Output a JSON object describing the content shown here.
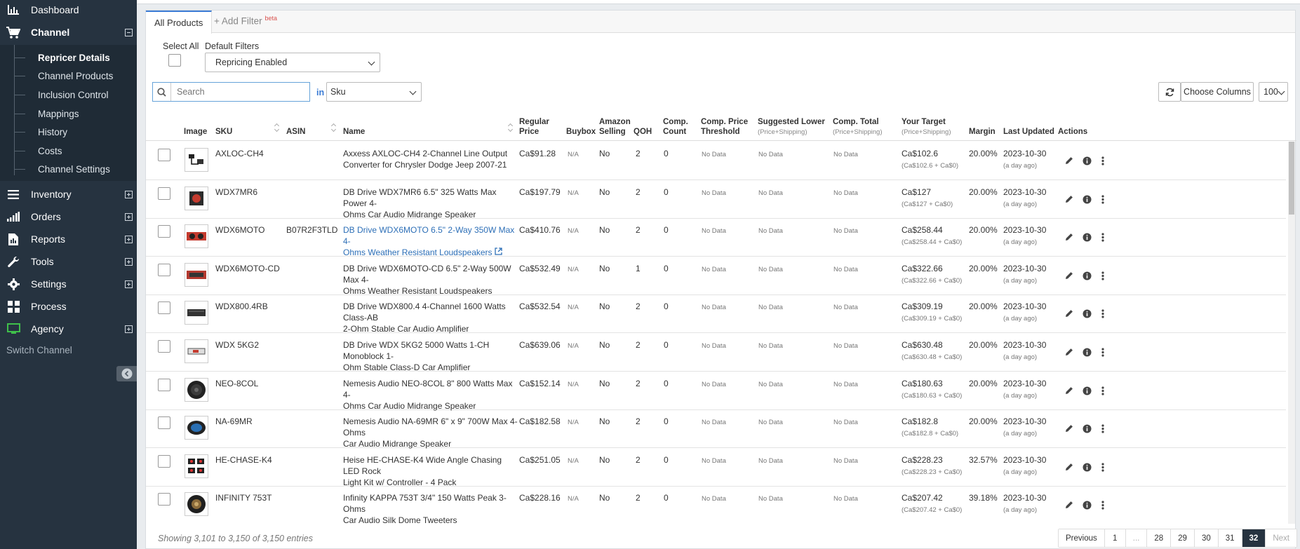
{
  "sidebar": {
    "items": [
      {
        "label": "Dashboard",
        "icon": "bar-chart-icon"
      },
      {
        "label": "Channel",
        "icon": "cart-icon"
      },
      {
        "label": "Inventory",
        "icon": "list-icon"
      },
      {
        "label": "Orders",
        "icon": "signal-icon"
      },
      {
        "label": "Reports",
        "icon": "report-icon"
      },
      {
        "label": "Tools",
        "icon": "wrench-icon"
      },
      {
        "label": "Settings",
        "icon": "gear-icon"
      },
      {
        "label": "Process",
        "icon": "process-icon"
      },
      {
        "label": "Agency",
        "icon": "monitor-icon"
      }
    ],
    "submenu": [
      {
        "label": "Repricer Details"
      },
      {
        "label": "Channel Products"
      },
      {
        "label": "Inclusion Control"
      },
      {
        "label": "Mappings"
      },
      {
        "label": "History"
      },
      {
        "label": "Costs"
      },
      {
        "label": "Channel Settings"
      }
    ],
    "switch_channel": "Switch Channel"
  },
  "tabs": {
    "all_products": "All Products",
    "add_filter": "Add Filter",
    "beta": "beta"
  },
  "filters": {
    "select_all": "Select All",
    "default_filters": "Default Filters",
    "default_filter_value": "Repricing Enabled",
    "search_placeholder": "Search",
    "in": "in",
    "search_field": "Sku",
    "choose_columns": "Choose Columns",
    "page_size": "100"
  },
  "columns": {
    "image": "Image",
    "sku": "SKU",
    "asin": "ASIN",
    "name": "Name",
    "regular_price_1": "Regular",
    "regular_price_2": "Price",
    "buybox": "Buybox",
    "amazon_selling_1": "Amazon",
    "amazon_selling_2": "Selling",
    "qoh": "QOH",
    "comp_count_1": "Comp.",
    "comp_count_2": "Count",
    "comp_threshold_1": "Comp. Price",
    "comp_threshold_2": "Threshold",
    "suggested_lower": "Suggested Lower",
    "suggested_lower_sub": "(Price+Shipping)",
    "comp_total": "Comp. Total",
    "comp_total_sub": "(Price+Shipping)",
    "your_target": "Your Target",
    "your_target_sub": "(Price+Shipping)",
    "margin": "Margin",
    "last_updated": "Last Updated",
    "actions": "Actions"
  },
  "rows": [
    {
      "sku": "AXLOC-CH4",
      "asin": "",
      "name1": "Axxess AXLOC-CH4 2-Channel Line Output",
      "name2": "Converter for Chrysler Dodge Jeep 2007-21",
      "price": "Ca$91.28",
      "buybox": "N/A",
      "amazon": "No",
      "qoh": "2",
      "count": "0",
      "threshold": "No Data",
      "suggested": "No Data",
      "comp_total": "No Data",
      "target": "Ca$102.6",
      "target_sub": "(Ca$102.6 + Ca$0)",
      "margin": "20.00%",
      "updated": "2023-10-30",
      "ago": "(a day ago)"
    },
    {
      "sku": "WDX7MR6",
      "asin": "",
      "name1": "DB Drive WDX7MR6 6.5\" 325 Watts Max Power 4-",
      "name2": "Ohms Car Audio Midrange Speaker",
      "price": "Ca$197.79",
      "buybox": "N/A",
      "amazon": "No",
      "qoh": "2",
      "count": "0",
      "threshold": "No Data",
      "suggested": "No Data",
      "comp_total": "No Data",
      "target": "Ca$127",
      "target_sub": "(Ca$127 + Ca$0)",
      "margin": "20.00%",
      "updated": "2023-10-30",
      "ago": "(a day ago)"
    },
    {
      "sku": "WDX6MOTO",
      "asin": "B07R2F3TLD",
      "name1": "DB Drive WDX6MOTO 6.5\" 2-Way 350W Max 4-",
      "name2": "Ohms Weather Resistant Loudspeakers",
      "price": "Ca$410.76",
      "buybox": "N/A",
      "amazon": "No",
      "qoh": "2",
      "count": "0",
      "threshold": "No Data",
      "suggested": "No Data",
      "comp_total": "No Data",
      "target": "Ca$258.44",
      "target_sub": "(Ca$258.44 + Ca$0)",
      "margin": "20.00%",
      "updated": "2023-10-30",
      "ago": "(a day ago)"
    },
    {
      "sku": "WDX6MOTO-CD",
      "asin": "",
      "name1": "DB Drive WDX6MOTO-CD 6.5\" 2-Way 500W Max 4-",
      "name2": "Ohms Weather Resistant Loudspeakers",
      "price": "Ca$532.49",
      "buybox": "N/A",
      "amazon": "No",
      "qoh": "1",
      "count": "0",
      "threshold": "No Data",
      "suggested": "No Data",
      "comp_total": "No Data",
      "target": "Ca$322.66",
      "target_sub": "(Ca$322.66 + Ca$0)",
      "margin": "20.00%",
      "updated": "2023-10-30",
      "ago": "(a day ago)"
    },
    {
      "sku": "WDX800.4RB",
      "asin": "",
      "name1": "DB Drive WDX800.4 4-Channel 1600 Watts Class-AB",
      "name2": "2-Ohm Stable Car Audio Amplifier",
      "price": "Ca$532.54",
      "buybox": "N/A",
      "amazon": "No",
      "qoh": "2",
      "count": "0",
      "threshold": "No Data",
      "suggested": "No Data",
      "comp_total": "No Data",
      "target": "Ca$309.19",
      "target_sub": "(Ca$309.19 + Ca$0)",
      "margin": "20.00%",
      "updated": "2023-10-30",
      "ago": "(a day ago)"
    },
    {
      "sku": "WDX 5KG2",
      "asin": "",
      "name1": "DB Drive WDX 5KG2 5000 Watts 1-CH Monoblock 1-",
      "name2": "Ohm Stable Class-D Car Amplifier",
      "price": "Ca$639.06",
      "buybox": "N/A",
      "amazon": "No",
      "qoh": "2",
      "count": "0",
      "threshold": "No Data",
      "suggested": "No Data",
      "comp_total": "No Data",
      "target": "Ca$630.48",
      "target_sub": "(Ca$630.48 + Ca$0)",
      "margin": "20.00%",
      "updated": "2023-10-30",
      "ago": "(a day ago)"
    },
    {
      "sku": "NEO-8COL",
      "asin": "",
      "name1": "Nemesis Audio NEO-8COL 8\" 800 Watts Max 4-",
      "name2": "Ohms Car Audio Midrange Speaker",
      "price": "Ca$152.14",
      "buybox": "N/A",
      "amazon": "No",
      "qoh": "2",
      "count": "0",
      "threshold": "No Data",
      "suggested": "No Data",
      "comp_total": "No Data",
      "target": "Ca$180.63",
      "target_sub": "(Ca$180.63 + Ca$0)",
      "margin": "20.00%",
      "updated": "2023-10-30",
      "ago": "(a day ago)"
    },
    {
      "sku": "NA-69MR",
      "asin": "",
      "name1": "Nemesis Audio NA-69MR 6\" x 9\" 700W Max 4-Ohms",
      "name2": "Car Audio Midrange Speaker",
      "price": "Ca$182.58",
      "buybox": "N/A",
      "amazon": "No",
      "qoh": "2",
      "count": "0",
      "threshold": "No Data",
      "suggested": "No Data",
      "comp_total": "No Data",
      "target": "Ca$182.8",
      "target_sub": "(Ca$182.8 + Ca$0)",
      "margin": "20.00%",
      "updated": "2023-10-30",
      "ago": "(a day ago)"
    },
    {
      "sku": "HE-CHASE-K4",
      "asin": "",
      "name1": "Heise HE-CHASE-K4 Wide Angle Chasing LED Rock",
      "name2": "Light Kit w/ Controller - 4 Pack",
      "price": "Ca$251.05",
      "buybox": "N/A",
      "amazon": "No",
      "qoh": "2",
      "count": "0",
      "threshold": "No Data",
      "suggested": "No Data",
      "comp_total": "No Data",
      "target": "Ca$228.23",
      "target_sub": "(Ca$228.23 + Ca$0)",
      "margin": "32.57%",
      "updated": "2023-10-30",
      "ago": "(a day ago)"
    },
    {
      "sku": "INFINITY 753T",
      "asin": "",
      "name1": "Infinity KAPPA 753T 3/4\" 150 Watts Peak 3-Ohms",
      "name2": "Car Audio Silk Dome Tweeters",
      "price": "Ca$228.16",
      "buybox": "N/A",
      "amazon": "No",
      "qoh": "2",
      "count": "0",
      "threshold": "No Data",
      "suggested": "No Data",
      "comp_total": "No Data",
      "target": "Ca$207.42",
      "target_sub": "(Ca$207.42 + Ca$0)",
      "margin": "39.18%",
      "updated": "2023-10-30",
      "ago": "(a day ago)"
    }
  ],
  "footer": {
    "info": "Showing 3,101 to 3,150 of 3,150 entries",
    "pages": [
      "Previous",
      "1",
      "...",
      "28",
      "29",
      "30",
      "31",
      "32",
      "Next"
    ],
    "active_page": "32"
  },
  "colors": {
    "sidebar": "#263340",
    "accent": "#3a7bd5",
    "link": "#2d6fb7"
  }
}
